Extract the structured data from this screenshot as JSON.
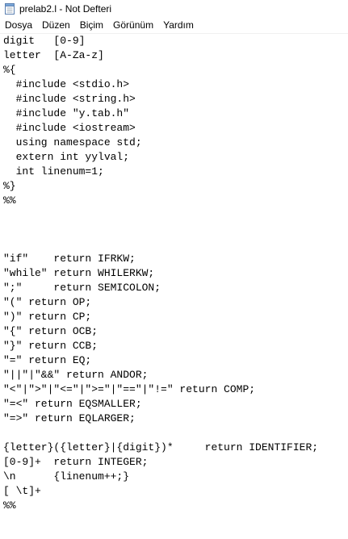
{
  "window": {
    "title": "prelab2.l - Not Defteri"
  },
  "menu": {
    "items": [
      "Dosya",
      "Düzen",
      "Biçim",
      "Görünüm",
      "Yardım"
    ]
  },
  "editor": {
    "lines": [
      "digit   [0-9]",
      "letter  [A-Za-z]",
      "%{",
      "  #include <stdio.h>",
      "  #include <string.h>",
      "  #include \"y.tab.h\"",
      "  #include <iostream>",
      "  using namespace std;",
      "  extern int yylval;",
      "  int linenum=1;",
      "%}",
      "%%",
      "",
      "",
      "",
      "\"if\"    return IFRKW;",
      "\"while\" return WHILERKW;",
      "\";\"     return SEMICOLON;",
      "\"(\" return OP;",
      "\")\" return CP;",
      "\"{\" return OCB;",
      "\"}\" return CCB;",
      "\"=\" return EQ;",
      "\"||\"|\"&&\" return ANDOR;",
      "\"<\"|\">\"|\"<=\"|\">=\"|\"==\"|\"!=\" return COMP;",
      "\"=<\" return EQSMALLER;",
      "\"=>\" return EQLARGER;",
      "",
      "{letter}({letter}|{digit})*     return IDENTIFIER;",
      "[0-9]+  return INTEGER;",
      "\\n      {linenum++;}",
      "[ \\t]+",
      "%%"
    ]
  }
}
